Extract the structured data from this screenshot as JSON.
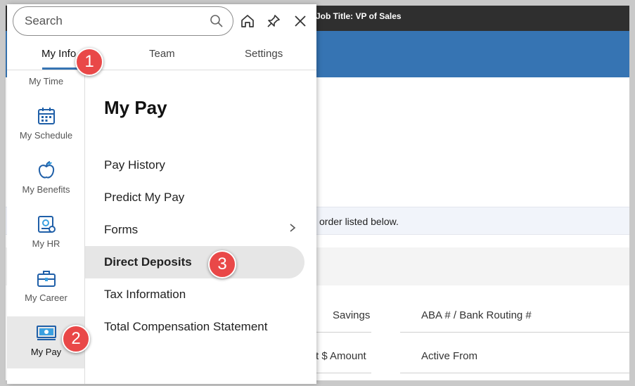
{
  "background": {
    "job_title": "Job Title: VP of Sales",
    "info_text": "order listed below.",
    "col_savings": "Savings",
    "col_aba": "ABA # / Bank Routing #",
    "col_amount": "t $ Amount",
    "col_active_from": "Active From"
  },
  "search": {
    "placeholder": "Search"
  },
  "toolbar": {
    "icons": [
      "home-icon",
      "pin-icon",
      "close-icon"
    ]
  },
  "tabs": [
    {
      "label": "My Info"
    },
    {
      "label": "Team"
    },
    {
      "label": "Settings"
    }
  ],
  "sidebar": {
    "items": [
      {
        "label": "My Time",
        "icon": "clock-icon"
      },
      {
        "label": "My Schedule",
        "icon": "calendar-icon"
      },
      {
        "label": "My Benefits",
        "icon": "apple-icon"
      },
      {
        "label": "My HR",
        "icon": "hr-document-icon"
      },
      {
        "label": "My Career",
        "icon": "briefcase-icon"
      },
      {
        "label": "My Pay",
        "icon": "pay-icon"
      }
    ]
  },
  "content": {
    "title": "My Pay",
    "menu": [
      {
        "label": "Pay History"
      },
      {
        "label": "Predict My Pay"
      },
      {
        "label": "Forms"
      },
      {
        "label": "Direct Deposits"
      },
      {
        "label": "Tax Information"
      },
      {
        "label": "Total Compensation Statement"
      }
    ]
  },
  "badges": [
    "1",
    "2",
    "3"
  ],
  "colors": {
    "accent": "#3674b3",
    "badge": "#e94848",
    "icon_blue": "#1f5fa8"
  }
}
